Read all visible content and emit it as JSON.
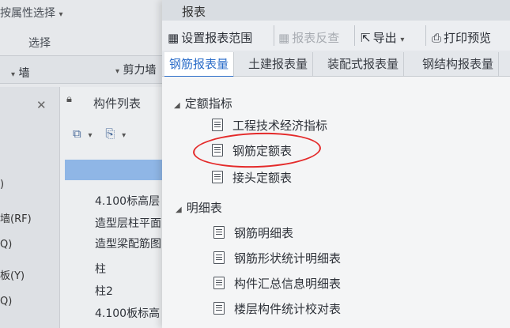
{
  "left": {
    "title": "按属性选择",
    "select_label": "选择",
    "wall_label": "墙",
    "cut_label": "剪力墙",
    "panel_title": "构件列表",
    "nav_items": [
      ")",
      "墙(RF)",
      "Q)",
      "板(Y)",
      "Q)"
    ],
    "panel_items": [
      "4.100标高层",
      "造型层柱平面",
      "造型梁配筋图",
      "柱",
      "柱2",
      "4.100板标高"
    ]
  },
  "report": {
    "window_title": "报表",
    "toolbar": {
      "set_range": "设置报表范围",
      "report_anti": "报表反查",
      "export": "导出",
      "print_preview": "打印预览"
    },
    "tabs": [
      "钢筋报表量",
      "土建报表量",
      "装配式报表量",
      "钢结构报表量"
    ],
    "active_tab": 0,
    "categories": [
      {
        "label": "定额指标",
        "items": [
          "工程技术经济指标",
          "钢筋定额表",
          "接头定额表"
        ]
      },
      {
        "label": "明细表",
        "items": [
          "钢筋明细表",
          "钢筋形状统计明细表",
          "构件汇总信息明细表",
          "楼层构件统计校对表"
        ]
      }
    ],
    "highlighted_item": "钢筋定额表",
    "annotation_color": "#e42a2a",
    "accent_color": "#2d6ec9"
  }
}
